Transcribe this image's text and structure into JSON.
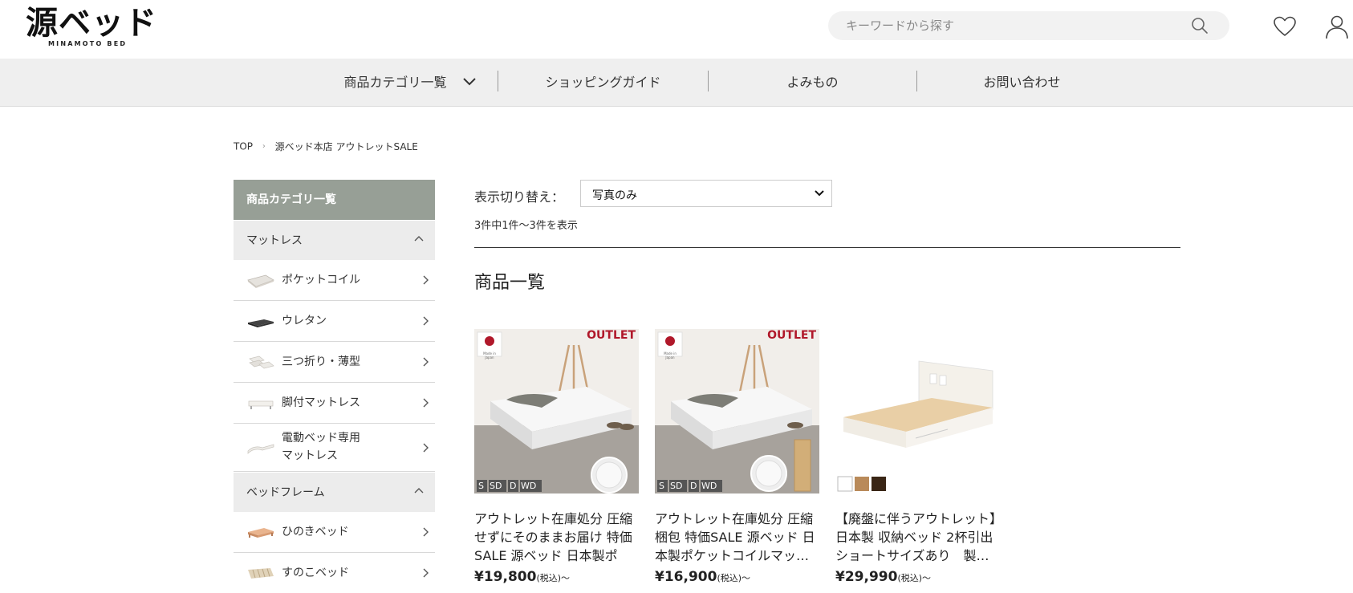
{
  "header": {
    "logo_main": "源ベッド",
    "logo_sub": "MINAMOTO BED",
    "search_placeholder": "キーワードから探す"
  },
  "nav": {
    "items": [
      {
        "label": "商品カテゴリ一覧"
      },
      {
        "label": "ショッピングガイド"
      },
      {
        "label": "よみもの"
      },
      {
        "label": "お問い合わせ"
      }
    ]
  },
  "breadcrumb": {
    "home": "TOP",
    "current": "源ベッド本店 アウトレットSALE"
  },
  "sidebar": {
    "title": "商品カテゴリ一覧",
    "groups": [
      {
        "label": "マットレス",
        "items": [
          {
            "label": "ポケットコイル"
          },
          {
            "label": "ウレタン"
          },
          {
            "label": "三つ折り・薄型"
          },
          {
            "label": "脚付マットレス"
          },
          {
            "label_line1": "電動ベッド専用",
            "label_line2": "マットレス"
          }
        ]
      },
      {
        "label": "ベッドフレーム",
        "items": [
          {
            "label": "ひのきベッド"
          },
          {
            "label": "すのこベッド"
          }
        ]
      }
    ]
  },
  "main": {
    "view_label": "表示切り替え：",
    "view_selected": "写真のみ",
    "count_text": "3件中1件〜3件を表示",
    "section_title": "商品一覧",
    "products": [
      {
        "badge": "OUTLET",
        "sizes": [
          "S",
          "SD",
          "D",
          "WD"
        ],
        "title": "アウトレット在庫処分 圧縮せずにそのままお届け 特価SALE 源ベッド 日本製ポケ…",
        "price": "¥19,800",
        "price_suffix": "(税込)〜",
        "flag_text": "Made in Japan"
      },
      {
        "badge": "OUTLET",
        "sizes": [
          "S",
          "SD",
          "D",
          "WD"
        ],
        "title": "アウトレット在庫処分 圧縮梱包 特価SALE 源ベッド 日本製ポケットコイルマッ…",
        "price": "¥16,900",
        "price_suffix": "(税込)〜",
        "flag_text": "Made in Japan"
      },
      {
        "title": "【廃盤に伴うアウトレット】日本製 収納ベッド 2杯引出 ショートサイズあり　製…",
        "price": "¥29,990",
        "price_suffix": "(税込)〜",
        "swatches": [
          "#ffffff",
          "#b98a5a",
          "#3a2616"
        ]
      }
    ]
  },
  "colors": {
    "sidebar_head": "#979f96",
    "nav_bg": "#efefef",
    "outlet_red": "#b0182a"
  }
}
